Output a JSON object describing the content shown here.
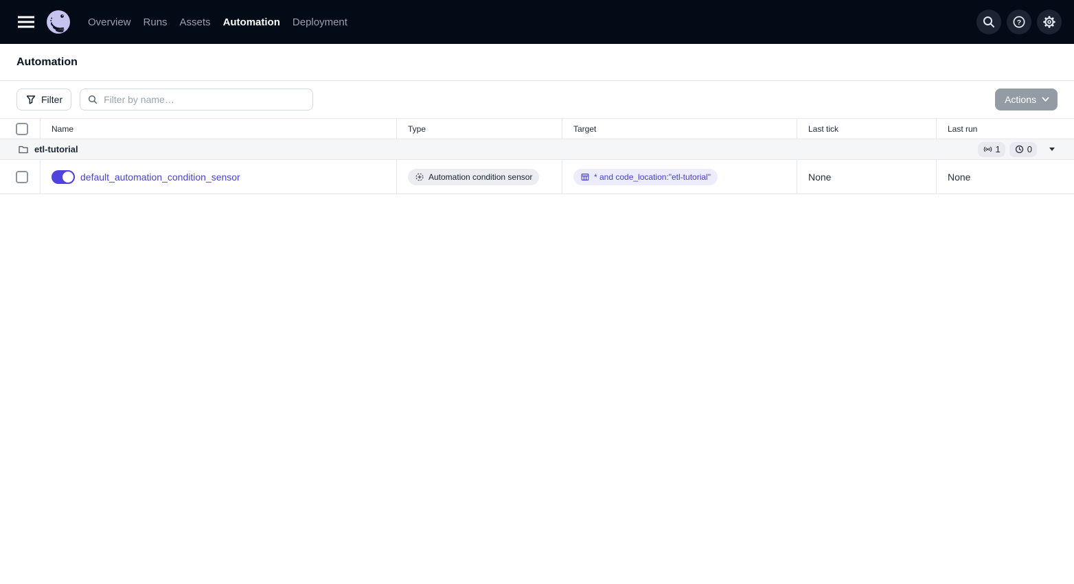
{
  "nav": {
    "items": [
      {
        "label": "Overview",
        "active": false
      },
      {
        "label": "Runs",
        "active": false
      },
      {
        "label": "Assets",
        "active": false
      },
      {
        "label": "Automation",
        "active": true
      },
      {
        "label": "Deployment",
        "active": false
      }
    ]
  },
  "page": {
    "title": "Automation"
  },
  "toolbar": {
    "filter_label": "Filter",
    "search_placeholder": "Filter by name…",
    "actions_label": "Actions"
  },
  "table": {
    "headers": [
      "Name",
      "Type",
      "Target",
      "Last tick",
      "Last run"
    ],
    "group": {
      "name": "etl-tutorial",
      "sensor_count": "1",
      "schedule_count": "0"
    },
    "rows": [
      {
        "name": "default_automation_condition_sensor",
        "enabled": true,
        "type": "Automation condition sensor",
        "target": "* and code_location:\"etl-tutorial\"",
        "last_tick": "None",
        "last_run": "None"
      }
    ]
  },
  "colors": {
    "topbar_bg": "#030B17",
    "accent_indigo": "#4F43DD",
    "link": "#4742CB",
    "group_row_bg": "#F5F6F8",
    "badge_gray_bg": "#EBEDF1",
    "badge_indigo_bg": "#ECECFD",
    "border": "#E4E7EB"
  }
}
